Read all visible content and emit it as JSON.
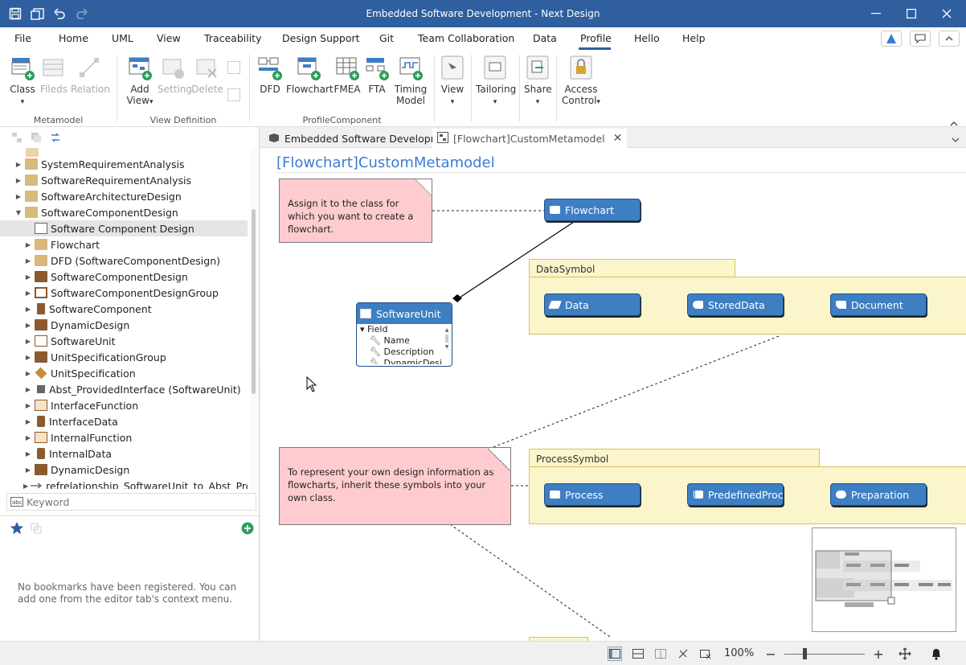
{
  "window": {
    "title": "Embedded Software Development - Next Design"
  },
  "menu": [
    "File",
    "Home",
    "UML",
    "View",
    "Traceability",
    "Design Support",
    "Git",
    "Team Collaboration",
    "Data",
    "Profile",
    "Hello",
    "Help"
  ],
  "active_menu": "Profile",
  "ribbon": {
    "class": "Class",
    "fields": "Fileds",
    "relation": "Relation",
    "add_view_1": "Add",
    "add_view_2": "View",
    "setting": "Setting",
    "delete": "Delete",
    "dfd": "DFD",
    "flowchart": "Flowchart",
    "fmea": "FMEA",
    "fta": "FTA",
    "timing_1": "Timing",
    "timing_2": "Model",
    "view": "View",
    "tailoring": "Tailoring",
    "share": "Share",
    "access_1": "Access",
    "access_2": "Control",
    "group_metamodel": "Metamodel",
    "group_view_definition": "View Definition",
    "group_profile_component": "ProfileComponent"
  },
  "tree": [
    {
      "label": "SystemRequirementAnalysis"
    },
    {
      "label": "SoftwareRequirementAnalysis"
    },
    {
      "label": "SoftwareArchitectureDesign"
    },
    {
      "label": "SoftwareComponentDesign"
    },
    {
      "label": "Software Component Design"
    },
    {
      "label": "Flowchart"
    },
    {
      "label": "DFD (SoftwareComponentDesign)"
    },
    {
      "label": "SoftwareComponentDesign"
    },
    {
      "label": "SoftwareComponentDesignGroup"
    },
    {
      "label": "SoftwareComponent"
    },
    {
      "label": "DynamicDesign"
    },
    {
      "label": "SoftwareUnit"
    },
    {
      "label": "UnitSpecificationGroup"
    },
    {
      "label": "UnitSpecification"
    },
    {
      "label": "Abst_ProvidedInterface (SoftwareUnit)"
    },
    {
      "label": "InterfaceFunction"
    },
    {
      "label": "InterfaceData"
    },
    {
      "label": "InternalFunction"
    },
    {
      "label": "InternalData"
    },
    {
      "label": "DynamicDesign"
    },
    {
      "label": "refrelationship_SoftwareUnit_to_Abst_Pro"
    }
  ],
  "search": {
    "placeholder": "Keyword"
  },
  "bookmarks": {
    "empty_text": "No bookmarks have been registered. You can add one from the editor tab's context menu."
  },
  "tabs": {
    "tab1": "Embedded Software Development",
    "tab2": "[Flowchart]CustomMetamodel"
  },
  "diagram": {
    "title": "[Flowchart]CustomMetamodel",
    "note1": "Assign it to the class for which you want to create a flowchart.",
    "note2": "To represent your own design information as flowcharts, inherit these symbols into your own class.",
    "flowchart": "Flowchart",
    "software_unit": "SoftwareUnit",
    "field_section": "Field",
    "fields": [
      "Name",
      "Description",
      "DynamicDesi"
    ],
    "data_symbol": "DataSymbol",
    "data": "Data",
    "stored_data": "StoredData",
    "document": "Document",
    "process_symbol": "ProcessSymbol",
    "process": "Process",
    "predefined_process": "PredefinedProce",
    "preparation": "Preparation"
  },
  "status": {
    "zoom": "100%"
  },
  "colors": {
    "title_bar": "#2f5f9f",
    "accent": "#3a7bd5",
    "class_fill": "#3e7fc4",
    "note_fill": "#fecccf",
    "package_fill": "#fbf5cc"
  }
}
